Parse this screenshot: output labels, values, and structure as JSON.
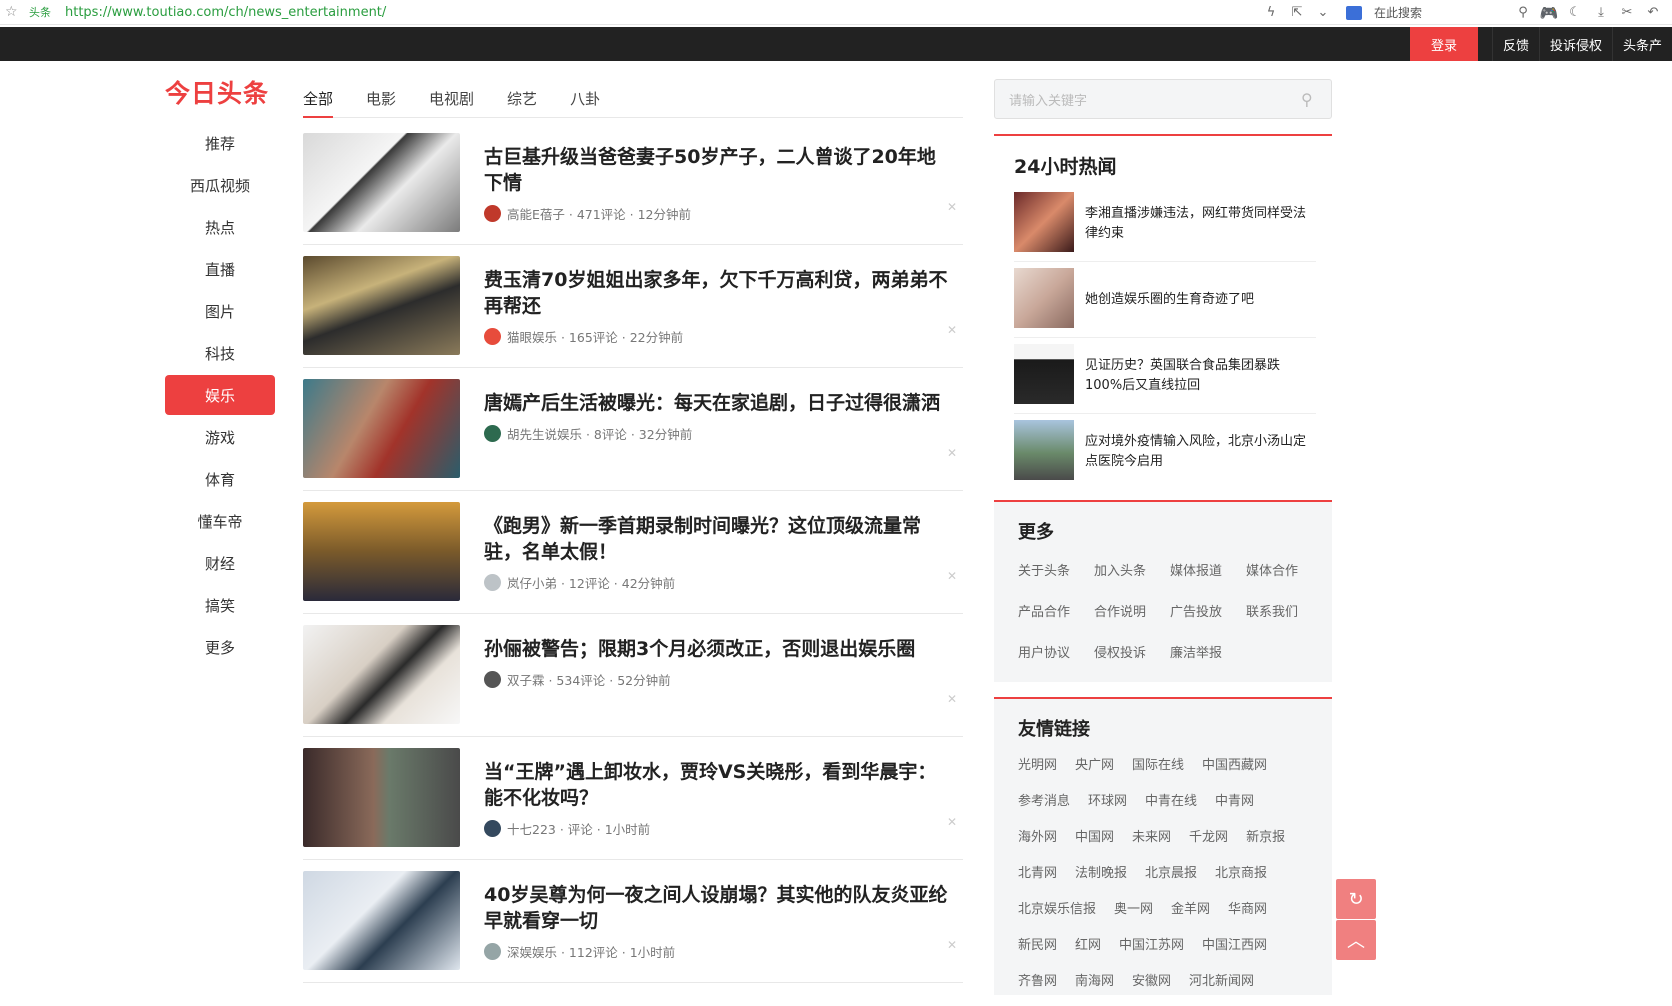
{
  "browser": {
    "site_tag": "头条",
    "url": "https://www.toutiao.com/ch/news_entertainment/",
    "search_placeholder": "在此搜索"
  },
  "topnav": {
    "login": "登录",
    "items": [
      "反馈",
      "投诉侵权",
      "头条产"
    ]
  },
  "logo": "今日头条",
  "sidebar": {
    "items": [
      "推荐",
      "西瓜视频",
      "热点",
      "直播",
      "图片",
      "科技",
      "娱乐",
      "游戏",
      "体育",
      "懂车帝",
      "财经",
      "搞笑",
      "更多"
    ],
    "active": "娱乐"
  },
  "tabs": [
    "全部",
    "电影",
    "电视剧",
    "综艺",
    "八卦"
  ],
  "feed": [
    {
      "title": "古巨基升级当爸爸妻子50岁产子，二人曾谈了20年地下情",
      "meta": "高能E蓓子 · 471评论 · 12分钟前"
    },
    {
      "title": "费玉清70岁姐姐出家多年，欠下千万高利贷，两弟弟不再帮还",
      "meta": "猫眼娱乐 · 165评论 · 22分钟前"
    },
    {
      "title": "唐嫣产后生活被曝光：每天在家追剧，日子过得很潇洒",
      "meta": "胡先生说娱乐 · 8评论 · 32分钟前"
    },
    {
      "title": "《跑男》新一季首期录制时间曝光？这位顶级流量常驻，名单太假！",
      "meta": "岚仔小弟 · 12评论 · 42分钟前"
    },
    {
      "title": "孙俪被警告；限期3个月必须改正，否则退出娱乐圈",
      "meta": "双子霖 · 534评论 · 52分钟前"
    },
    {
      "title": "当“王牌”遇上卸妆水，贾玲VS关晓彤，看到华晨宇：能不化妆吗？",
      "meta": "十七223 · 评论 · 1小时前"
    },
    {
      "title": "40岁吴尊为何一夜之间人设崩塌？其实他的队友炎亚纶早就看穿一切",
      "meta": "深娱娱乐 · 112评论 · 1小时前"
    }
  ],
  "right": {
    "search_placeholder": "请输入关键字",
    "hot_title": "24小时热闻",
    "hot": [
      "李湘直播涉嫌违法，网红带货同样受法律约束",
      "她创造娱乐圈的生育奇迹了吧",
      "见证历史？英国联合食品集团暴跌100%后又直线拉回",
      "应对境外疫情输入风险，北京小汤山定点医院今启用"
    ],
    "more_title": "更多",
    "more_links": [
      "关于头条",
      "加入头条",
      "媒体报道",
      "媒体合作",
      "产品合作",
      "合作说明",
      "广告投放",
      "联系我们",
      "用户协议",
      "侵权投诉",
      "廉洁举报"
    ],
    "friends_title": "友情链接",
    "friend_links": [
      "光明网",
      "央广网",
      "国际在线",
      "中国西藏网",
      "参考消息",
      "环球网",
      "中青在线",
      "中青网",
      "海外网",
      "中国网",
      "未来网",
      "千龙网",
      "新京报",
      "北青网",
      "法制晚报",
      "北京晨报",
      "北京商报",
      "北京娱乐信报",
      "奥一网",
      "金羊网",
      "华商网",
      "新民网",
      "红网",
      "中国江苏网",
      "中国江西网",
      "齐鲁网",
      "南海网",
      "安徽网",
      "河北新闻网"
    ]
  }
}
